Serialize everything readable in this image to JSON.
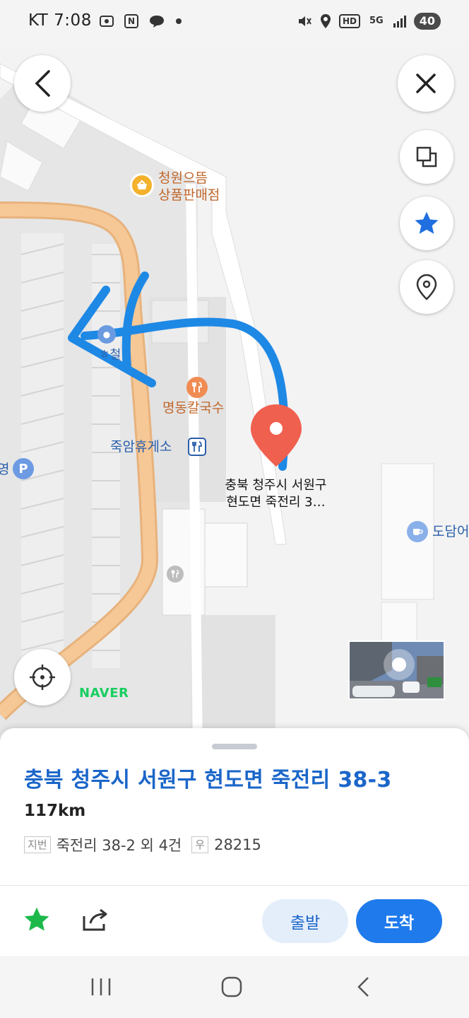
{
  "status_bar": {
    "carrier": "KT",
    "time": "7:08",
    "notification_n": "N",
    "hd": "HD",
    "network": "5G",
    "battery": "40"
  },
  "map": {
    "pois": {
      "store": "청원으뜸\n상품판매점",
      "restaurant": "명동칼국수",
      "rest_area": "죽암휴게소",
      "parking_partial": "ㅎ철",
      "parking_left": "영",
      "right_place": "도담어",
      "marker_label": "충북 청주시 서원구\n현도면 죽전리 3…"
    },
    "brand": "NAVER"
  },
  "place": {
    "address": "충북 청주시 서원구 현도면 죽전리 38-3",
    "distance": "117km",
    "lot_tag": "지번",
    "lot": "죽전리 38-2 외 4건",
    "zip_tag": "우",
    "zip": "28215"
  },
  "actions": {
    "start": "출발",
    "arrive": "도착"
  },
  "colors": {
    "accent": "#1f7aec",
    "title": "#1b66c9",
    "marker": "#f0604f",
    "road": "#f5c896",
    "annotation": "#1e88e5",
    "favorite": "#1cb94a"
  }
}
